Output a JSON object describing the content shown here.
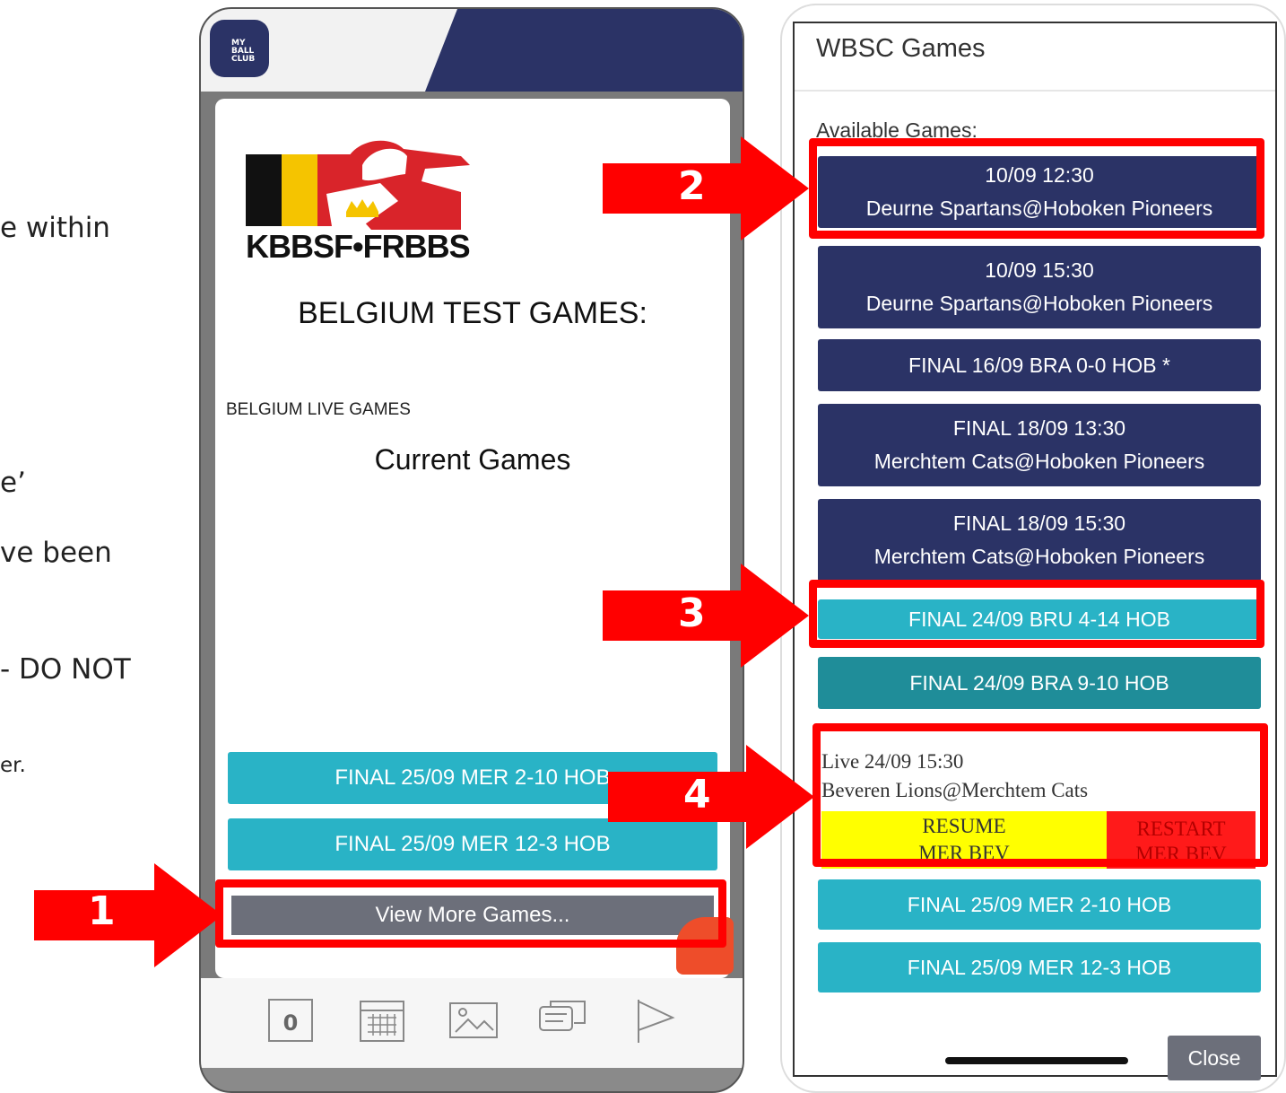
{
  "slide_fragments": [
    "e within",
    "e’",
    "ve been",
    "- DO NOT",
    "er."
  ],
  "phone_left": {
    "app_logo": "MY BALL CLUB",
    "org_logo_text": "KBBSF•FRBBS",
    "title": "BELGIUM TEST GAMES:",
    "section_label": "BELGIUM LIVE GAMES",
    "current_games_heading": "Current Games",
    "games": [
      "FINAL 25/09 MER 2-10 HOB",
      "FINAL 25/09 MER 12-3 HOB"
    ],
    "view_more": "View More Games...",
    "tabbar": {
      "count": "0",
      "icons": [
        "counter-icon",
        "calendar-icon",
        "image-icon",
        "chat-icon",
        "flag-icon"
      ]
    }
  },
  "phone_right": {
    "title": "WBSC Games",
    "available_label": "Available Games:",
    "games": [
      {
        "line1": "10/09 12:30",
        "line2": "Deurne Spartans@Hoboken Pioneers",
        "style": "navy"
      },
      {
        "line1": "10/09 15:30",
        "line2": "Deurne Spartans@Hoboken Pioneers",
        "style": "navy"
      },
      {
        "line1": "FINAL 16/09 BRA 0-0 HOB *",
        "line2": "",
        "style": "navy"
      },
      {
        "line1": "FINAL 18/09 13:30",
        "line2": "Merchtem Cats@Hoboken Pioneers",
        "style": "navy"
      },
      {
        "line1": "FINAL 18/09 15:30",
        "line2": "Merchtem Cats@Hoboken Pioneers",
        "style": "navy"
      },
      {
        "line1": "FINAL 24/09 BRU 4-14 HOB",
        "line2": "",
        "style": "teal"
      },
      {
        "line1": "FINAL 24/09 BRA 9-10 HOB",
        "line2": "",
        "style": "teal-dark"
      }
    ],
    "live_game": {
      "line1": "Live 24/09 15:30",
      "line2": "Beveren Lions@Merchtem Cats",
      "resume_line1": "RESUME",
      "resume_line2": "MER BEV",
      "restart_line1": "RESTART",
      "restart_line2": "MER BEV"
    },
    "final_games": [
      "FINAL 25/09 MER 2-10 HOB",
      "FINAL 25/09 MER 12-3 HOB"
    ],
    "close_label": "Close"
  },
  "annotations": {
    "arrow_labels": [
      "1",
      "2",
      "3",
      "4"
    ],
    "highlight_color": "#ff0000"
  },
  "colors": {
    "navy": "#2b3366",
    "teal": "#29b3c6",
    "teal_dark": "#1f8d99",
    "gray_button": "#6c6f7a",
    "resume_yellow": "#ffff00",
    "restart_red": "#ff1a1a"
  }
}
